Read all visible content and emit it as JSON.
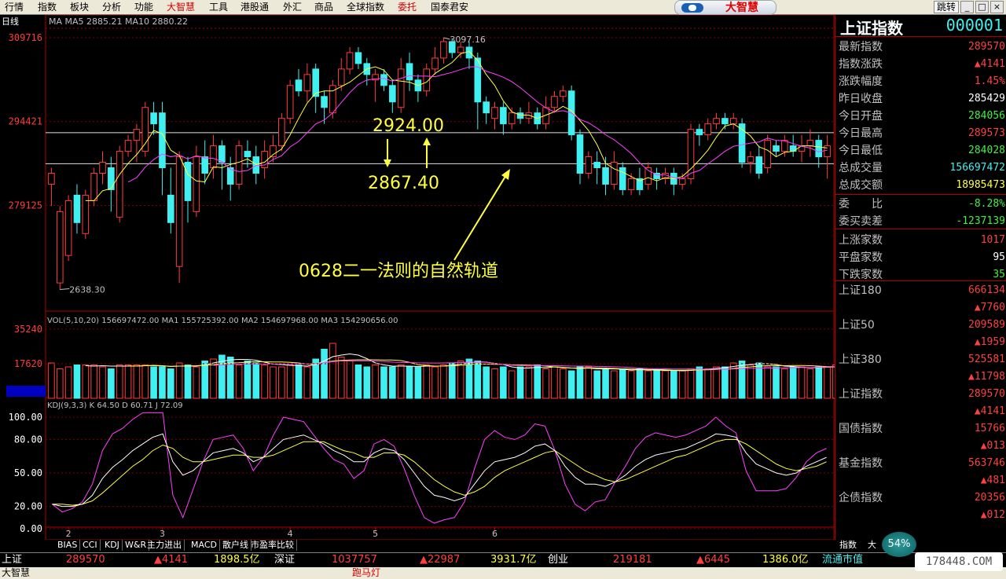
{
  "menu": [
    "行情",
    "指数",
    "板块",
    "分析",
    "功能",
    "大智慧",
    "工具",
    "港股通",
    "外汇",
    "商品",
    "全球指数",
    "委托",
    "国泰君安"
  ],
  "menu_highlight": [
    "大智慧",
    "委托"
  ],
  "logo_text": "大智慧",
  "jump_button": "跳转",
  "panel": {
    "name": "上证指数",
    "code": "000001",
    "rows": [
      {
        "label": "最新指数",
        "value": "289570",
        "color": "#ff4040"
      },
      {
        "label": "指数涨跌",
        "value": "▲4141",
        "color": "#ff4040"
      },
      {
        "label": "涨跌幅度",
        "value": "1.45%",
        "color": "#ff4040"
      },
      {
        "label": "昨日收盘",
        "value": "285429",
        "color": "#ffffff"
      },
      {
        "label": "今日开盘",
        "value": "284056",
        "color": "#40f040"
      },
      {
        "label": "今日最高",
        "value": "289573",
        "color": "#ff4040"
      },
      {
        "label": "今日最低",
        "value": "284028",
        "color": "#40f040"
      },
      {
        "label": "总成交量",
        "value": "156697472",
        "color": "#40f0f0"
      },
      {
        "label": "总成交额",
        "value": "18985473",
        "color": "#ffff40"
      },
      {
        "label": "委　　比",
        "value": "-8.28%",
        "color": "#40f040"
      },
      {
        "label": "委买卖差",
        "value": "-1237139",
        "color": "#40f040"
      },
      {
        "label": "上涨家数",
        "value": "1017",
        "color": "#ff4040"
      },
      {
        "label": "平盘家数",
        "value": "95",
        "color": "#ffffff"
      },
      {
        "label": "下跌家数",
        "value": "35",
        "color": "#40f040"
      }
    ],
    "indices": [
      {
        "label": "上证180",
        "value": "666134",
        "change": "▲7760"
      },
      {
        "label": "上证50",
        "value": "209589",
        "change": "▲1959"
      },
      {
        "label": "上证380",
        "value": "525581",
        "change": "▲11798"
      },
      {
        "label": "上证指数",
        "value": "289570",
        "change": "▲4141"
      },
      {
        "label": "国债指数",
        "value": "15766",
        "change": "▲013"
      },
      {
        "label": "基金指数",
        "value": "563746",
        "change": "▲481"
      },
      {
        "label": "企债指数",
        "value": "20356",
        "change": "▲012"
      }
    ]
  },
  "tabs": [
    "BIAS",
    "CCI",
    "KDJ",
    "W&R",
    "主力进出",
    "MACD",
    "散户线",
    "市盈率比较"
  ],
  "right_tabs": [
    "指数",
    "大"
  ],
  "status": {
    "sh_label": "上证",
    "sh_value": "289570",
    "sh_change": "▲4141",
    "sh_amount": "1898.5亿",
    "sz_label": "深证",
    "sz_value": "1037757",
    "sz_change": "▲22987",
    "sz_amount": "3931.7亿",
    "cy_label": "创业",
    "cy_value": "219181",
    "cy_change": "▲6445",
    "cy_amount": "1386.0亿",
    "flow_label": "流通市值"
  },
  "bottom": {
    "app": "大智慧",
    "marquee": "跑马灯"
  },
  "cpu_pct": "54%",
  "watermark": "178448.COM",
  "chart_data": {
    "type": "candlestick",
    "period_label": "日线",
    "ma_legend": "MA MA5 2885.21 MA10 2880.22",
    "price_ticks": [
      "309716",
      "294421",
      "279125"
    ],
    "price_range": [
      2600,
      3110
    ],
    "high_label": "3097.16",
    "low_label": "2638.30",
    "annotations": {
      "upper": "2924.00",
      "lower": "2867.40",
      "text": "0628二一法则的自然轨道"
    },
    "ref_lines": [
      2924.0,
      2867.4
    ],
    "x_ticks": [
      "2",
      "3",
      "4",
      "5",
      "6"
    ],
    "x_tick_index": [
      2,
      13,
      28,
      38,
      52
    ],
    "candles": [
      [
        2830,
        2850,
        2790,
        2860
      ],
      [
        2650,
        2780,
        2638,
        2790
      ],
      [
        2700,
        2800,
        2690,
        2810
      ],
      [
        2810,
        2760,
        2740,
        2830
      ],
      [
        2740,
        2810,
        2730,
        2820
      ],
      [
        2800,
        2850,
        2790,
        2860
      ],
      [
        2850,
        2870,
        2830,
        2890
      ],
      [
        2860,
        2820,
        2780,
        2880
      ],
      [
        2770,
        2890,
        2760,
        2900
      ],
      [
        2890,
        2910,
        2880,
        2920
      ],
      [
        2910,
        2930,
        2870,
        2940
      ],
      [
        2890,
        2970,
        2880,
        2980
      ],
      [
        2960,
        2940,
        2920,
        2980
      ],
      [
        2960,
        2860,
        2810,
        2980
      ],
      [
        2810,
        2760,
        2740,
        2860
      ],
      [
        2680,
        2880,
        2650,
        2890
      ],
      [
        2870,
        2800,
        2760,
        2880
      ],
      [
        2780,
        2880,
        2770,
        2900
      ],
      [
        2880,
        2850,
        2830,
        2910
      ],
      [
        2860,
        2900,
        2840,
        2920
      ],
      [
        2900,
        2870,
        2820,
        2910
      ],
      [
        2860,
        2830,
        2800,
        2880
      ],
      [
        2830,
        2900,
        2820,
        2910
      ],
      [
        2890,
        2880,
        2860,
        2910
      ],
      [
        2880,
        2850,
        2830,
        2900
      ],
      [
        2860,
        2890,
        2840,
        2910
      ],
      [
        2880,
        2900,
        2870,
        2920
      ],
      [
        2900,
        2950,
        2890,
        2960
      ],
      [
        2950,
        3010,
        2940,
        3020
      ],
      [
        3020,
        3000,
        2990,
        3040
      ],
      [
        3000,
        3030,
        2980,
        3050
      ],
      [
        3040,
        2990,
        2960,
        3050
      ],
      [
        2990,
        2970,
        2940,
        3000
      ],
      [
        2960,
        3010,
        2950,
        3020
      ],
      [
        3010,
        3040,
        3000,
        3060
      ],
      [
        3040,
        3070,
        3030,
        3080
      ],
      [
        3070,
        3050,
        3040,
        3080
      ],
      [
        3050,
        3030,
        3010,
        3060
      ],
      [
        3020,
        3030,
        2980,
        3040
      ],
      [
        3030,
        3010,
        3000,
        3040
      ],
      [
        3010,
        2980,
        2960,
        3020
      ],
      [
        2970,
        3040,
        2960,
        3060
      ],
      [
        3050,
        3020,
        3000,
        3070
      ],
      [
        3020,
        3000,
        2980,
        3030
      ],
      [
        3000,
        3040,
        2990,
        3050
      ],
      [
        3040,
        3060,
        3030,
        3080
      ],
      [
        3060,
        3090,
        3050,
        3097.16
      ],
      [
        3090,
        3070,
        3060,
        3095
      ],
      [
        3070,
        3080,
        3060,
        3090
      ],
      [
        3080,
        3060,
        3040,
        3090
      ],
      [
        3060,
        2980,
        2930,
        3070
      ],
      [
        2980,
        2960,
        2940,
        2990
      ],
      [
        2950,
        2970,
        2930,
        2980
      ],
      [
        2970,
        2940,
        2920,
        2980
      ],
      [
        2940,
        2960,
        2930,
        2970
      ],
      [
        2960,
        2950,
        2940,
        2970
      ],
      [
        2950,
        2960,
        2940,
        2980
      ],
      [
        2960,
        2940,
        2930,
        2970
      ],
      [
        2940,
        2970,
        2930,
        2990
      ],
      [
        2970,
        2990,
        2960,
        3000
      ],
      [
        2990,
        3000,
        2980,
        3010
      ],
      [
        3000,
        2920,
        2910,
        3010
      ],
      [
        2920,
        2850,
        2830,
        2930
      ],
      [
        2850,
        2880,
        2840,
        2890
      ],
      [
        2870,
        2860,
        2830,
        2890
      ],
      [
        2860,
        2830,
        2810,
        2880
      ],
      [
        2830,
        2870,
        2820,
        2890
      ],
      [
        2860,
        2820,
        2810,
        2870
      ],
      [
        2820,
        2840,
        2810,
        2850
      ],
      [
        2840,
        2820,
        2810,
        2860
      ],
      [
        2830,
        2860,
        2820,
        2870
      ],
      [
        2850,
        2840,
        2820,
        2860
      ],
      [
        2840,
        2850,
        2830,
        2860
      ],
      [
        2850,
        2830,
        2810,
        2860
      ],
      [
        2830,
        2840,
        2820,
        2850
      ],
      [
        2840,
        2930,
        2830,
        2940
      ],
      [
        2930,
        2920,
        2900,
        2940
      ],
      [
        2920,
        2940,
        2910,
        2950
      ],
      [
        2940,
        2950,
        2930,
        2960
      ],
      [
        2950,
        2940,
        2930,
        2960
      ],
      [
        2940,
        2950,
        2930,
        2960
      ],
      [
        2940,
        2870,
        2860,
        2950
      ],
      [
        2870,
        2880,
        2850,
        2890
      ],
      [
        2880,
        2850,
        2840,
        2900
      ],
      [
        2860,
        2910,
        2850,
        2920
      ],
      [
        2900,
        2890,
        2880,
        2910
      ],
      [
        2890,
        2910,
        2880,
        2920
      ],
      [
        2900,
        2890,
        2880,
        2920
      ],
      [
        2890,
        2900,
        2870,
        2920
      ],
      [
        2900,
        2910,
        2880,
        2930
      ],
      [
        2910,
        2880,
        2860,
        2920
      ],
      [
        2880,
        2900,
        2840,
        2920
      ]
    ],
    "vol_legend": "VOL(5,10,20)  156697472.00  MA1  155725392.00  MA2  154697968.00  MA3  154290656.00",
    "vol_ticks": [
      "35240",
      "17620",
      "X10000"
    ],
    "volumes": [
      18,
      15,
      16,
      17,
      17,
      17,
      16,
      15,
      17,
      17,
      17,
      17,
      16,
      16,
      15,
      18,
      17,
      16,
      19,
      20,
      22,
      21,
      17,
      19,
      18,
      17,
      16,
      16,
      17,
      17,
      16,
      20,
      25,
      28,
      21,
      19,
      17,
      16,
      17,
      16,
      16,
      17,
      16,
      16,
      17,
      16,
      17,
      18,
      19,
      20,
      19,
      16,
      15,
      16,
      14,
      16,
      16,
      17,
      15,
      16,
      15,
      14,
      16,
      16,
      14,
      15,
      14,
      15,
      14,
      15,
      14,
      14,
      14,
      14,
      14,
      15,
      16,
      15,
      16,
      16,
      18,
      19,
      17,
      18,
      16,
      16,
      15,
      16,
      16,
      15,
      16,
      16,
      17
    ],
    "kdj_legend": "KDJ(9,3,3)  K 64.50  D 60.71  J 72.09",
    "kdj_ticks": [
      "100.00",
      "80.00",
      "50.00",
      "20.00",
      "0.00"
    ],
    "k": [
      22,
      20,
      20,
      22,
      30,
      45,
      55,
      62,
      70,
      76,
      82,
      85,
      60,
      48,
      52,
      60,
      68,
      70,
      72,
      68,
      60,
      64,
      72,
      80,
      82,
      84,
      80,
      76,
      70,
      66,
      60,
      60,
      68,
      72,
      70,
      62,
      50,
      38,
      30,
      28,
      25,
      28,
      40,
      52,
      60,
      62,
      64,
      68,
      74,
      76,
      70,
      56,
      46,
      40,
      40,
      38,
      42,
      48,
      56,
      62,
      66,
      68,
      70,
      72,
      76,
      80,
      85,
      84,
      82,
      68,
      58,
      54,
      50,
      48,
      50,
      56,
      60,
      64
    ],
    "d": [
      22,
      22,
      21,
      22,
      25,
      32,
      40,
      48,
      56,
      62,
      70,
      75,
      72,
      64,
      60,
      60,
      62,
      64,
      66,
      66,
      64,
      64,
      66,
      70,
      74,
      78,
      78,
      78,
      74,
      70,
      68,
      64,
      64,
      68,
      68,
      66,
      60,
      52,
      44,
      38,
      33,
      30,
      33,
      38,
      46,
      52,
      56,
      60,
      64,
      68,
      70,
      64,
      58,
      52,
      48,
      44,
      42,
      44,
      48,
      52,
      56,
      60,
      64,
      66,
      70,
      74,
      78,
      80,
      80,
      76,
      70,
      64,
      58,
      54,
      52,
      54,
      56,
      60
    ],
    "j": [
      22,
      15,
      18,
      24,
      40,
      70,
      85,
      90,
      98,
      104,
      106,
      105,
      30,
      10,
      35,
      60,
      80,
      82,
      84,
      72,
      52,
      64,
      84,
      100,
      98,
      96,
      84,
      72,
      62,
      58,
      45,
      52,
      76,
      80,
      74,
      54,
      30,
      10,
      5,
      8,
      10,
      24,
      54,
      80,
      88,
      82,
      80,
      84,
      94,
      92,
      70,
      40,
      22,
      16,
      24,
      26,
      42,
      56,
      72,
      82,
      86,
      84,
      82,
      84,
      88,
      92,
      100,
      92,
      86,
      52,
      34,
      34,
      34,
      36,
      46,
      60,
      68,
      72
    ]
  }
}
